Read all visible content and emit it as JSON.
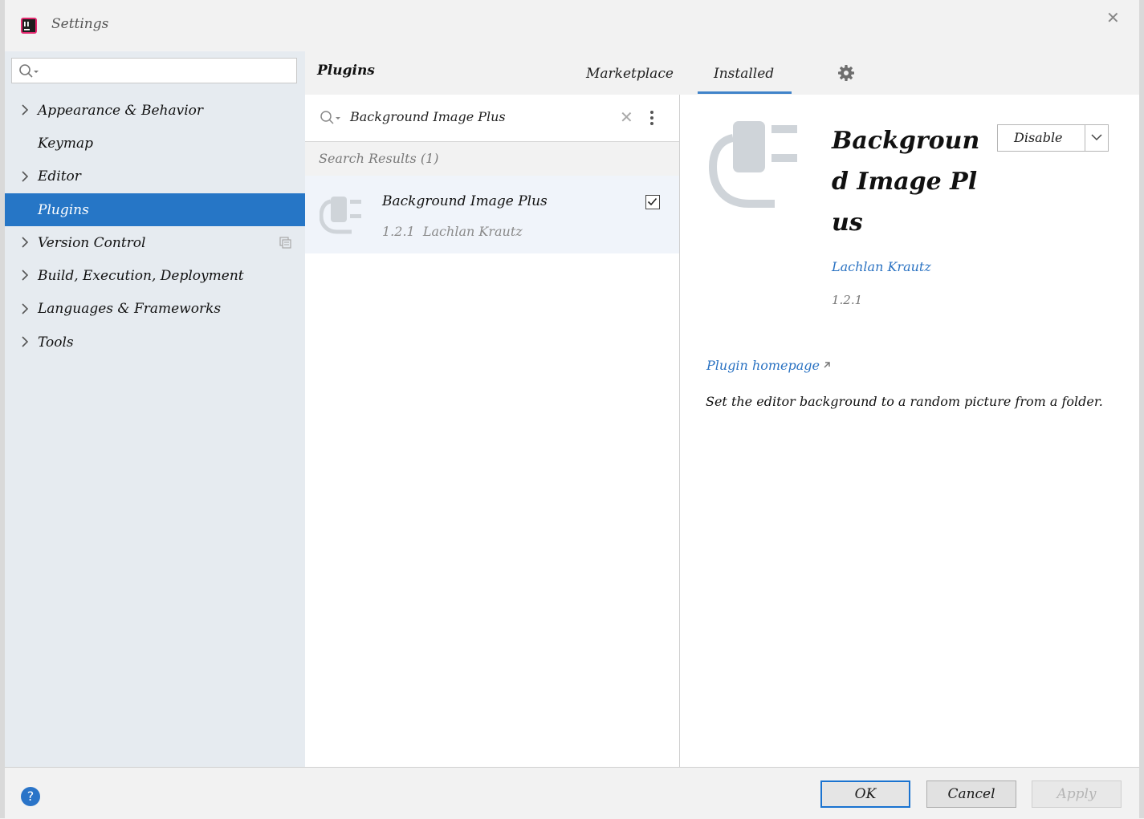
{
  "window": {
    "title": "Settings"
  },
  "sidebar": {
    "search_placeholder": "",
    "items": [
      {
        "label": "Appearance & Behavior",
        "expandable": true
      },
      {
        "label": "Keymap",
        "expandable": false
      },
      {
        "label": "Editor",
        "expandable": true
      },
      {
        "label": "Plugins",
        "expandable": false,
        "selected": true
      },
      {
        "label": "Version Control",
        "expandable": true
      },
      {
        "label": "Build, Execution, Deployment",
        "expandable": true
      },
      {
        "label": "Languages & Frameworks",
        "expandable": true
      },
      {
        "label": "Tools",
        "expandable": true
      }
    ]
  },
  "header": {
    "title": "Plugins",
    "tabs": [
      "Marketplace",
      "Installed"
    ],
    "active_tab": "Installed"
  },
  "plugin_list": {
    "search_value": "Background Image Plus",
    "results_label": "Search Results (1)",
    "items": [
      {
        "name": "Background Image Plus",
        "version": "1.2.1",
        "author": "Lachlan Krautz",
        "enabled": true
      }
    ]
  },
  "detail": {
    "name": "Background Image Plus",
    "action": "Disable",
    "author": "Lachlan Krautz",
    "version": "1.2.1",
    "homepage_label": "Plugin homepage",
    "description": "Set the editor background to a random picture from a folder."
  },
  "footer": {
    "help_label": "?",
    "ok_label": "OK",
    "cancel_label": "Cancel",
    "apply_label": "Apply"
  },
  "colors": {
    "selection": "#2676c6",
    "link": "#2a72c2",
    "sidebar_bg": "#e6ebf0"
  }
}
